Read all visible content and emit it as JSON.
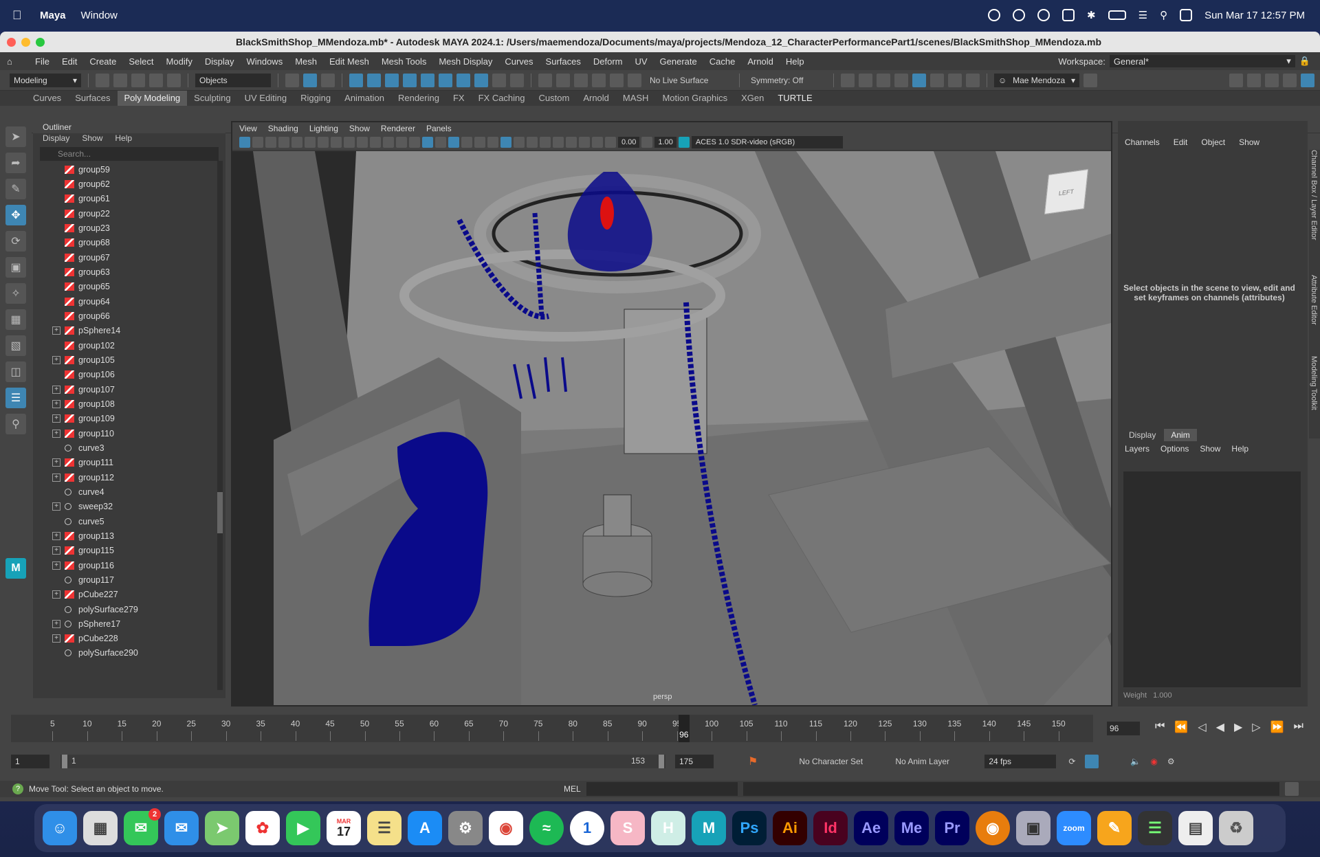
{
  "menubar": {
    "app_name": "Maya",
    "menu_window": "Window",
    "datetime": "Sun Mar 17  12:57 PM"
  },
  "titlebar": {
    "title": "BlackSmithShop_MMendoza.mb* - Autodesk MAYA 2024.1: /Users/maemendoza/Documents/maya/projects/Mendoza_12_CharacterPerformancePart1/scenes/BlackSmithShop_MMendoza.mb"
  },
  "main_menu": [
    "File",
    "Edit",
    "Create",
    "Select",
    "Modify",
    "Display",
    "Windows",
    "Mesh",
    "Edit Mesh",
    "Mesh Tools",
    "Mesh Display",
    "Curves",
    "Surfaces",
    "Deform",
    "UV",
    "Generate",
    "Cache",
    "Arnold",
    "Help"
  ],
  "workspace": {
    "label": "Workspace:",
    "value": "General*"
  },
  "statusline": {
    "mode": "Modeling",
    "selection_mode": "Objects",
    "live_surface": "No Live Surface",
    "symmetry": "Symmetry: Off",
    "user": "Mae Mendoza"
  },
  "shelf_tabs": [
    "Curves",
    "Surfaces",
    "Poly Modeling",
    "Sculpting",
    "UV Editing",
    "Rigging",
    "Animation",
    "Rendering",
    "FX",
    "FX Caching",
    "Custom",
    "Arnold",
    "MASH",
    "Motion Graphics",
    "XGen",
    "TURTLE"
  ],
  "shelf_active": "Poly Modeling",
  "outliner": {
    "title": "Outliner",
    "menu": [
      "Display",
      "Show",
      "Help"
    ],
    "search_placeholder": "Search...",
    "items": [
      {
        "name": "group59",
        "expandable": false,
        "type": "mesh"
      },
      {
        "name": "group62",
        "expandable": false,
        "type": "mesh"
      },
      {
        "name": "group61",
        "expandable": false,
        "type": "mesh"
      },
      {
        "name": "group22",
        "expandable": false,
        "type": "mesh"
      },
      {
        "name": "group23",
        "expandable": false,
        "type": "mesh"
      },
      {
        "name": "group68",
        "expandable": false,
        "type": "mesh"
      },
      {
        "name": "group67",
        "expandable": false,
        "type": "mesh"
      },
      {
        "name": "group63",
        "expandable": false,
        "type": "mesh"
      },
      {
        "name": "group65",
        "expandable": false,
        "type": "mesh"
      },
      {
        "name": "group64",
        "expandable": false,
        "type": "mesh"
      },
      {
        "name": "group66",
        "expandable": false,
        "type": "mesh"
      },
      {
        "name": "pSphere14",
        "expandable": true,
        "type": "mesh"
      },
      {
        "name": "group102",
        "expandable": false,
        "type": "mesh"
      },
      {
        "name": "group105",
        "expandable": true,
        "type": "mesh"
      },
      {
        "name": "group106",
        "expandable": false,
        "type": "mesh"
      },
      {
        "name": "group107",
        "expandable": true,
        "type": "mesh"
      },
      {
        "name": "group108",
        "expandable": true,
        "type": "mesh"
      },
      {
        "name": "group109",
        "expandable": true,
        "type": "mesh"
      },
      {
        "name": "group110",
        "expandable": true,
        "type": "mesh"
      },
      {
        "name": "curve3",
        "expandable": false,
        "type": "curve"
      },
      {
        "name": "group111",
        "expandable": true,
        "type": "mesh"
      },
      {
        "name": "group112",
        "expandable": true,
        "type": "mesh"
      },
      {
        "name": "curve4",
        "expandable": false,
        "type": "curve"
      },
      {
        "name": "sweep32",
        "expandable": true,
        "type": "group"
      },
      {
        "name": "curve5",
        "expandable": false,
        "type": "curve"
      },
      {
        "name": "group113",
        "expandable": true,
        "type": "mesh"
      },
      {
        "name": "group115",
        "expandable": true,
        "type": "mesh"
      },
      {
        "name": "group116",
        "expandable": true,
        "type": "mesh"
      },
      {
        "name": "group117",
        "expandable": false,
        "type": "group"
      },
      {
        "name": "pCube227",
        "expandable": true,
        "type": "mesh"
      },
      {
        "name": "polySurface279",
        "expandable": false,
        "type": "group"
      },
      {
        "name": "pSphere17",
        "expandable": true,
        "type": "group"
      },
      {
        "name": "pCube228",
        "expandable": true,
        "type": "mesh"
      },
      {
        "name": "polySurface290",
        "expandable": false,
        "type": "group"
      }
    ]
  },
  "viewport": {
    "menu": [
      "View",
      "Shading",
      "Lighting",
      "Show",
      "Renderer",
      "Panels"
    ],
    "exposure": "0.00",
    "gamma": "1.00",
    "color_space": "ACES 1.0 SDR-video (sRGB)",
    "camera": "persp",
    "view_cube": "LEFT"
  },
  "channel_box": {
    "menu": [
      "Channels",
      "Edit",
      "Object",
      "Show"
    ],
    "message": "Select objects in the scene to view, edit and set keyframes on channels (attributes)",
    "side_tabs": [
      "Channel Box / Layer Editor",
      "Attribute Editor",
      "Modeling Toolkit"
    ]
  },
  "layer_editor": {
    "tabs": [
      "Display",
      "Anim"
    ],
    "active_tab": "Anim",
    "menu": [
      "Layers",
      "Options",
      "Show",
      "Help"
    ],
    "weight_label": "Weight",
    "weight_value": "1.000"
  },
  "timeline": {
    "ticks": [
      "5",
      "10",
      "15",
      "20",
      "25",
      "30",
      "35",
      "40",
      "45",
      "50",
      "55",
      "60",
      "65",
      "70",
      "75",
      "80",
      "85",
      "90",
      "95",
      "100",
      "105",
      "110",
      "115",
      "120",
      "125",
      "130",
      "135",
      "140",
      "145",
      "150"
    ],
    "current_frame": "96",
    "current_frame_field": "96",
    "start": 1,
    "end": 153
  },
  "range": {
    "start_time": "1",
    "range_start": "1",
    "range_end": "153",
    "end_time": "175",
    "character_set": "No Character Set",
    "anim_layer": "No Anim Layer",
    "fps": "24 fps"
  },
  "helpline": {
    "text": "Move Tool: Select an object to move.",
    "mel_label": "MEL"
  },
  "dock": {
    "calendar_month": "MAR",
    "calendar_day": "17",
    "messages_badge": "2",
    "apps": [
      "Finder",
      "Launchpad",
      "Messages",
      "Mail",
      "Maps",
      "Photos",
      "FaceTime",
      "Calendar",
      "Notes",
      "App Store",
      "System Settings",
      "Chrome",
      "Spotify",
      "1Password",
      "S",
      "H",
      "Maya",
      "Ps",
      "Ai",
      "Id",
      "Ae",
      "Me",
      "Pr",
      "Blender",
      "Preview",
      "Zoom",
      "Pages",
      "Activity",
      "Doc",
      "Trash"
    ]
  },
  "colors": {
    "maya_blue": "#3e86b3",
    "scene_gray": "#7a7a7a",
    "mesh_blue": "#0a0a8a",
    "bulb_red": "#dd1111"
  }
}
